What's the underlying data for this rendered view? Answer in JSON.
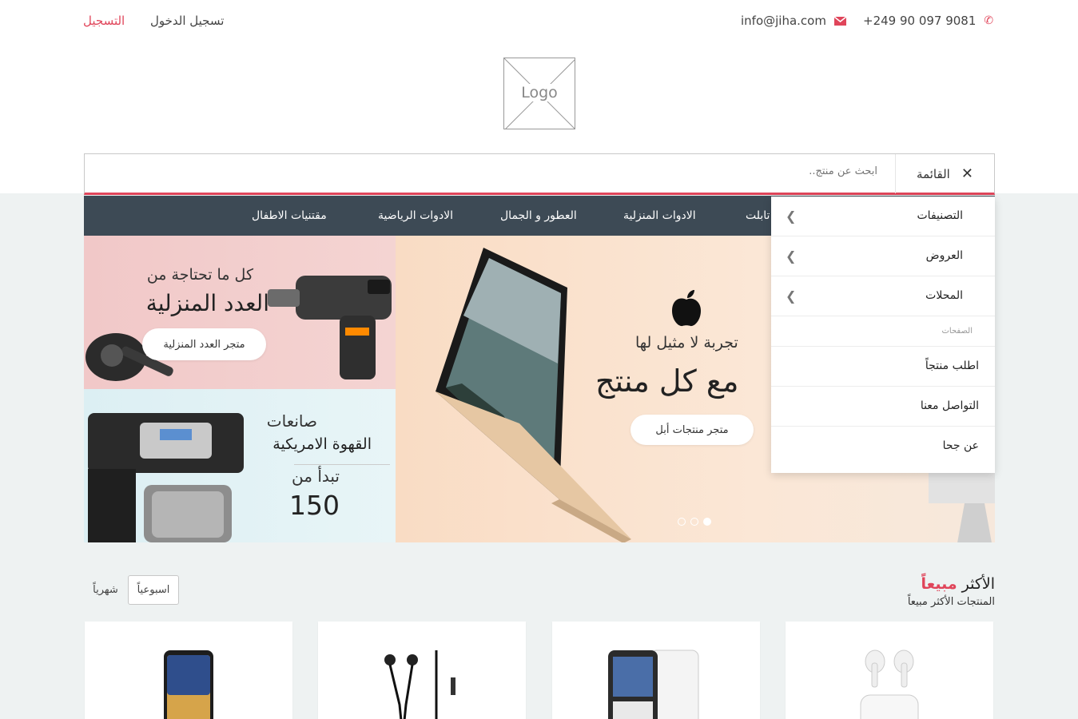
{
  "topbar": {
    "phone": "+249 90 097 9081",
    "email": "info@jiha.com",
    "login": "تسجيل الدخول",
    "register": "التسجيل"
  },
  "logo_text": "Logo",
  "search": {
    "placeholder": "ابحث عن منتج..",
    "menu_label": "القائمة"
  },
  "nav": {
    "items": [
      "مقتنيات الاطفال",
      "الادوات الرياضية",
      "العطور و الجمال",
      "الادوات المنزلية",
      "تابلت"
    ]
  },
  "dropdown": {
    "items": [
      {
        "label": "التصنيفات"
      },
      {
        "label": "العروض"
      },
      {
        "label": "المحلات"
      }
    ],
    "section_label": "الصفحات",
    "pages": [
      {
        "label": "اطلب منتجاً"
      },
      {
        "label": "التواصل معنا"
      },
      {
        "label": "عن جحا"
      }
    ]
  },
  "banners": {
    "tools": {
      "subtitle": "كل ما تحتاجة من",
      "title": "العدد المنزلية",
      "button": "متجر العدد المنزلية"
    },
    "coffee": {
      "line1": "صانعات",
      "line2": "القهوة الامريكية",
      "line3": "تبدأ من",
      "price": "150"
    },
    "apple": {
      "tagline": "تجربة لا مثيل لها",
      "headline": "مع كل منتج",
      "button": "متجر منتجات أبل"
    },
    "carousel_active_index": 2,
    "carousel_count": 3
  },
  "bestsellers": {
    "title_plain": "الأكثر",
    "title_accent": "مبيعاً",
    "subtitle": "المنتجات الأكثر مبيعاً",
    "tabs": [
      "اسبوعياً",
      "شهرياً"
    ]
  },
  "products": [
    {
      "icon": "airpods-icon"
    },
    {
      "icon": "blackberry-phone-icon"
    },
    {
      "icon": "earphones-icon"
    },
    {
      "icon": "smartphone-icon"
    }
  ],
  "colors": {
    "accent": "#e0455a",
    "nav_bg": "#3d4a55",
    "band_bg": "#eef2f2"
  }
}
